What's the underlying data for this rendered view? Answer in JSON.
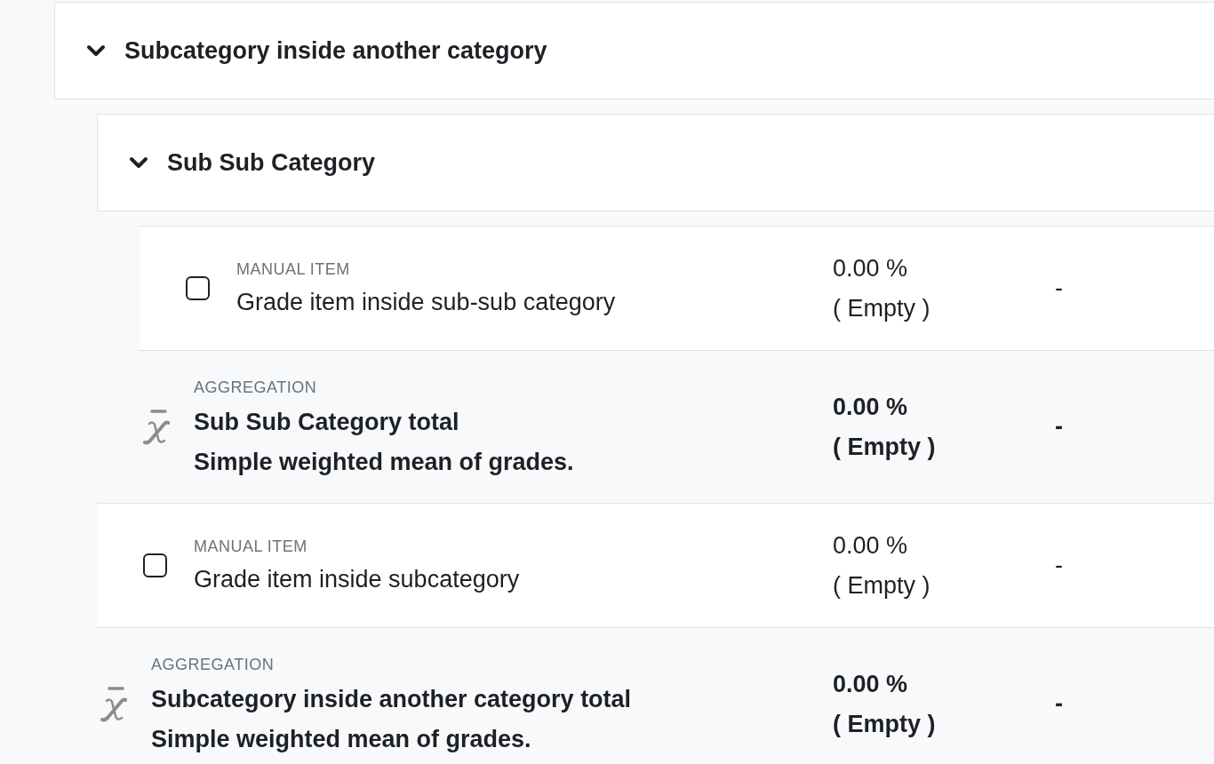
{
  "category": {
    "kind": "category",
    "title": "Subcategory inside another category",
    "expanded": true,
    "children": [
      {
        "kind": "category",
        "title": "Sub Sub Category",
        "expanded": true,
        "children": [
          {
            "kind": "item",
            "type_label": "MANUAL ITEM",
            "name": "Grade item inside sub-sub category",
            "checked": false,
            "column_2": [
              "0.00 %",
              "( Empty )"
            ],
            "column_3": "-"
          }
        ],
        "total": {
          "type_label": "AGGREGATION",
          "name": "Sub Sub Category total",
          "method": "Simple weighted mean of grades.",
          "column_2": [
            "0.00 %",
            "( Empty )"
          ],
          "column_3": "-"
        }
      },
      {
        "kind": "item",
        "type_label": "MANUAL ITEM",
        "name": "Grade item inside subcategory",
        "checked": false,
        "column_2": [
          "0.00 %",
          "( Empty )"
        ],
        "column_3": "-"
      }
    ],
    "total": {
      "type_label": "AGGREGATION",
      "name": "Subcategory inside another category total",
      "method": "Simple weighted mean of grades.",
      "column_2": [
        "0.00 %",
        "( Empty )"
      ],
      "column_3": "-"
    }
  }
}
